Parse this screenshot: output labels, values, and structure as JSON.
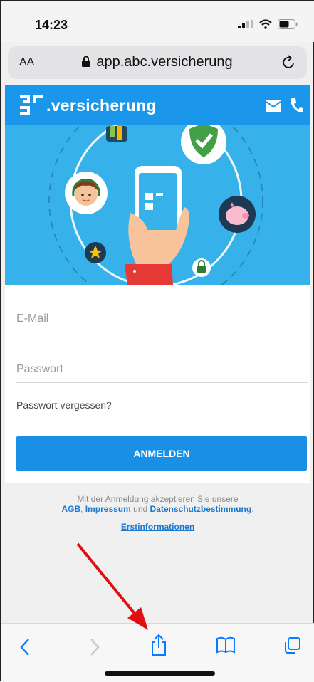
{
  "status": {
    "time": "14:23"
  },
  "browser": {
    "aa_label": "AA",
    "url": "app.abc.versicherung"
  },
  "header": {
    "brand": ".versicherung"
  },
  "form": {
    "email_placeholder": "E-Mail",
    "password_placeholder": "Passwort",
    "forgot_label": "Passwort vergessen?",
    "login_label": "ANMELDEN"
  },
  "legal": {
    "line1": "Mit der Anmeldung akzeptieren Sie unsere",
    "agb": "AGB",
    "sep1": ", ",
    "impressum": "Impressum",
    "und": " und ",
    "datenschutz": "Datenschutzbestimmung",
    "dot": ".",
    "erstinfo": "Erstinformationen"
  },
  "colors": {
    "brand_blue": "#1a96ea",
    "hero_blue": "#36b1ea",
    "ios_blue": "#0a7aff",
    "annotation_red": "#e01010"
  },
  "toolbar_icons": [
    "back-icon",
    "forward-icon",
    "share-icon",
    "bookmarks-icon",
    "tabs-icon"
  ]
}
